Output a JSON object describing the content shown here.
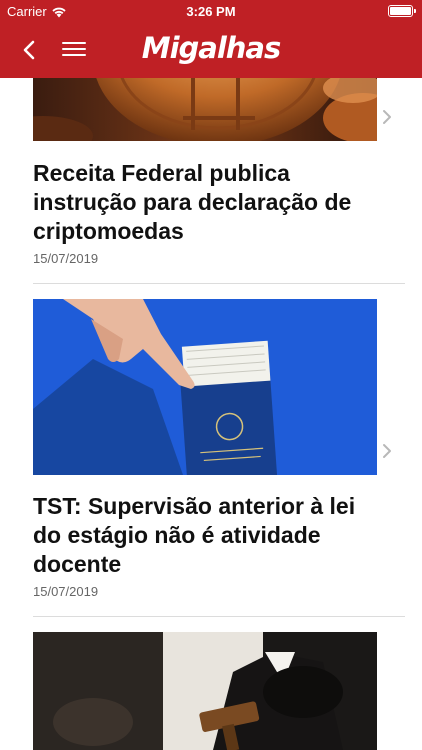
{
  "status_bar": {
    "carrier": "Carrier",
    "time": "3:26 PM",
    "battery_level": 1.0,
    "icons": [
      "wifi-icon",
      "battery-icon"
    ]
  },
  "nav": {
    "brand": "Migalhas",
    "icons": [
      "back-chevron-icon",
      "hamburger-menu-icon"
    ],
    "accent_color": "#bf2025"
  },
  "articles": [
    {
      "image": "bitcoin-coins-photo",
      "headline": "Receita Federal publica instrução para declaração de criptomoedas",
      "date": "15/07/2019"
    },
    {
      "image": "hand-with-work-card-photo",
      "headline": "TST: Supervisão anterior à lei do estágio não é atividade docente",
      "date": "15/07/2019"
    },
    {
      "image": "judge-gavel-photo",
      "headline": "",
      "date": ""
    }
  ]
}
